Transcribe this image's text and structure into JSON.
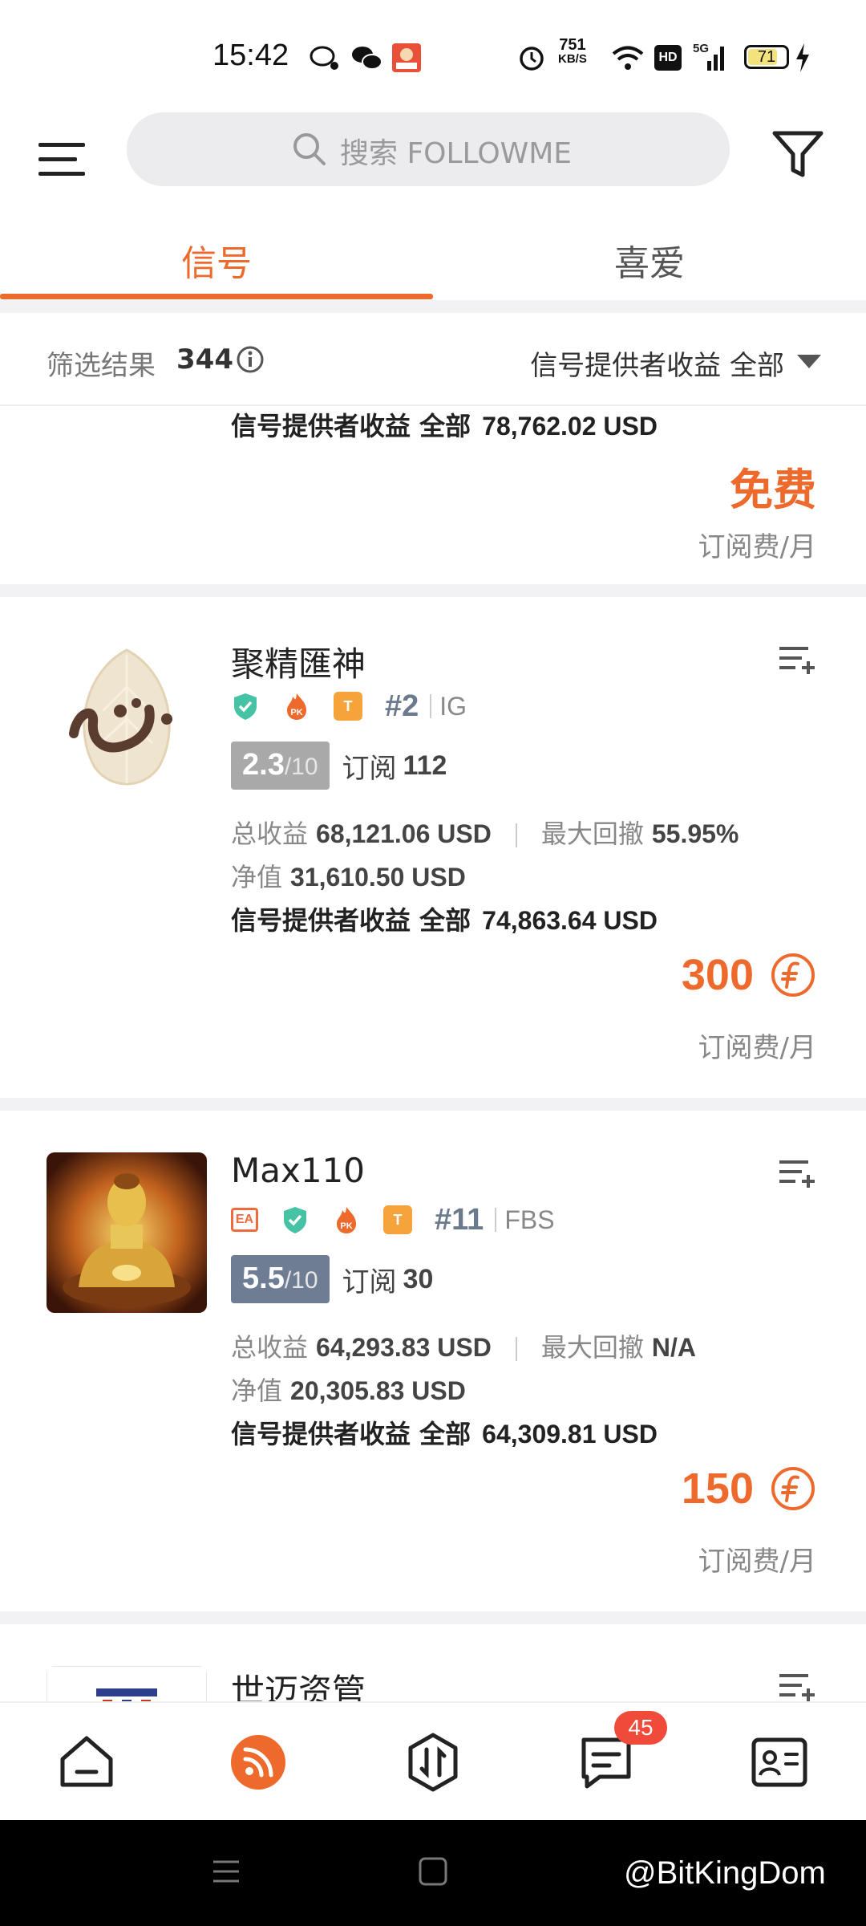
{
  "status_bar": {
    "time": "15:42",
    "net_speed_value": "751",
    "net_speed_unit": "KB/S",
    "hd": "HD",
    "network": "5G",
    "battery": "71"
  },
  "header": {
    "search_placeholder": "搜索 FOLLOWME"
  },
  "tabs": [
    {
      "label": "信号"
    },
    {
      "label": "喜爱"
    }
  ],
  "filter": {
    "result_label": "筛选结果",
    "result_count": "344",
    "sort_label": "信号提供者收益 全部"
  },
  "partial_card": {
    "provider_label": "信号提供者收益 全部",
    "provider_value": "78,762.02 USD",
    "price": "免费",
    "per_month": "订阅费/月"
  },
  "cards": [
    {
      "name": "聚精匯神",
      "rank": "#2",
      "broker": "IG",
      "score": "2.3",
      "score_den": "/10",
      "sub_label": "订阅",
      "sub_count": "112",
      "total_label": "总收益",
      "total_value": "68,121.06 USD",
      "drawdown_label": "最大回撤",
      "drawdown_value": "55.95%",
      "equity_label": "净值",
      "equity_value": "31,610.50 USD",
      "provider_label": "信号提供者收益 全部",
      "provider_value": "74,863.64 USD",
      "price": "300",
      "per_month": "订阅费/月",
      "score_color": "#a9a9aa"
    },
    {
      "name": "Max110",
      "ea": "EA",
      "rank": "#11",
      "broker": "FBS",
      "score": "5.5",
      "score_den": "/10",
      "sub_label": "订阅",
      "sub_count": "30",
      "total_label": "总收益",
      "total_value": "64,293.83 USD",
      "drawdown_label": "最大回撤",
      "drawdown_value": "N/A",
      "equity_label": "净值",
      "equity_value": "20,305.83 USD",
      "provider_label": "信号提供者收益 全部",
      "provider_value": "64,309.81 USD",
      "price": "150",
      "per_month": "订阅费/月",
      "score_color": "#6e7d93"
    },
    {
      "name": "世迈资管"
    }
  ],
  "bottom_nav": {
    "messages_badge": "45",
    "active": "signals",
    "accent": "#ee6a2c"
  },
  "watermark": "@BitKingDom"
}
